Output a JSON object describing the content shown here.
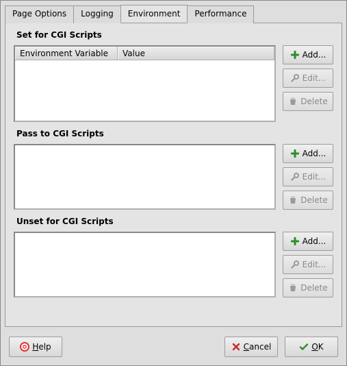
{
  "tabs": {
    "page_options": "Page Options",
    "logging": "Logging",
    "environment": "Environment",
    "performance": "Performance"
  },
  "sections": {
    "set": {
      "title": "Set for CGI Scripts",
      "columns": {
        "var": "Environment Variable",
        "value": "Value"
      },
      "rows": []
    },
    "pass": {
      "title": "Pass to CGI Scripts",
      "rows": []
    },
    "unset": {
      "title": "Unset for CGI Scripts",
      "rows": []
    }
  },
  "buttons": {
    "add": "Add...",
    "edit": "Edit...",
    "delete": "Delete",
    "help_prefix": "H",
    "help_rest": "elp",
    "cancel_prefix": "C",
    "cancel_rest": "ancel",
    "ok_prefix": "O",
    "ok_rest": "K"
  },
  "icons": {
    "add": "plus-green",
    "edit": "wrench",
    "delete": "trash",
    "help": "lifebuoy",
    "cancel": "cross-red",
    "ok": "check-green"
  },
  "state": {
    "edit_enabled": false,
    "delete_enabled": false
  }
}
